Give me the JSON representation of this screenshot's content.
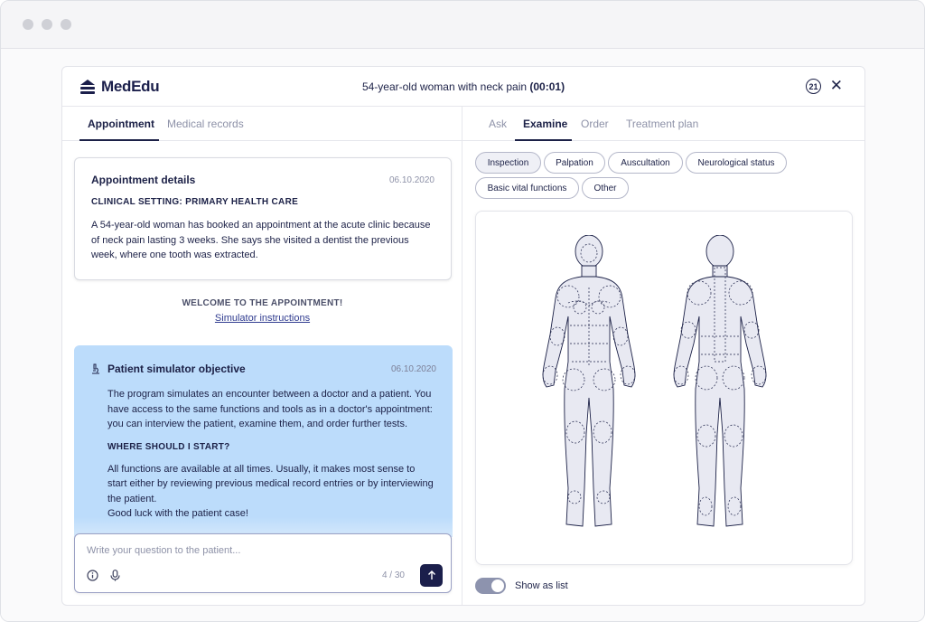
{
  "app": {
    "logo_text": "MedEdu",
    "case_title": "54-year-old woman with neck pain",
    "case_timer": "(00:01)",
    "counter_badge": "21",
    "close_label": "✕"
  },
  "left_tabs": [
    {
      "label": "Appointment",
      "active": true
    },
    {
      "label": "Medical records",
      "active": false
    }
  ],
  "appointment_card": {
    "title": "Appointment details",
    "date": "06.10.2020",
    "setting": "CLINICAL SETTING: PRIMARY HEALTH CARE",
    "text": "A 54-year-old woman has booked an appointment at the acute clinic because of neck pain lasting 3 weeks. She says she visited a dentist the previous week, where one tooth was extracted."
  },
  "welcome": {
    "heading": "WELCOME TO THE APPOINTMENT!",
    "link": "Simulator instructions"
  },
  "objective": {
    "title": "Patient simulator objective",
    "date": "06.10.2020",
    "paragraph1": "The program simulates an encounter between a doctor and a patient. You have access to the same functions and tools as in a doctor's appointment: you can interview the patient, examine them, and order further tests.",
    "subheading": "WHERE SHOULD I START?",
    "paragraph2": "All functions are available at all times. Usually, it makes most sense to start either by reviewing previous medical record entries or by interviewing the patient.",
    "paragraph3": "Good luck with the patient case!"
  },
  "composer": {
    "placeholder": "Write your question to the patient...",
    "value": "",
    "char_count": "4 / 30"
  },
  "right_tabs": [
    {
      "label": "Ask",
      "active": false
    },
    {
      "label": "Examine",
      "active": true
    },
    {
      "label": "Order",
      "active": false
    },
    {
      "label": "Treatment plan",
      "active": false
    }
  ],
  "exam_chips": [
    {
      "label": "Inspection",
      "active": true
    },
    {
      "label": "Palpation",
      "active": false
    },
    {
      "label": "Auscultation",
      "active": false
    },
    {
      "label": "Neurological status",
      "active": false
    },
    {
      "label": "Basic vital functions",
      "active": false
    },
    {
      "label": "Other",
      "active": false
    }
  ],
  "toggle": {
    "label": "Show as list",
    "on": true
  },
  "colors": {
    "brand_navy": "#1b1f4b",
    "objective_bg": "#bcdcfb",
    "body_fill": "#e8e9f2"
  }
}
